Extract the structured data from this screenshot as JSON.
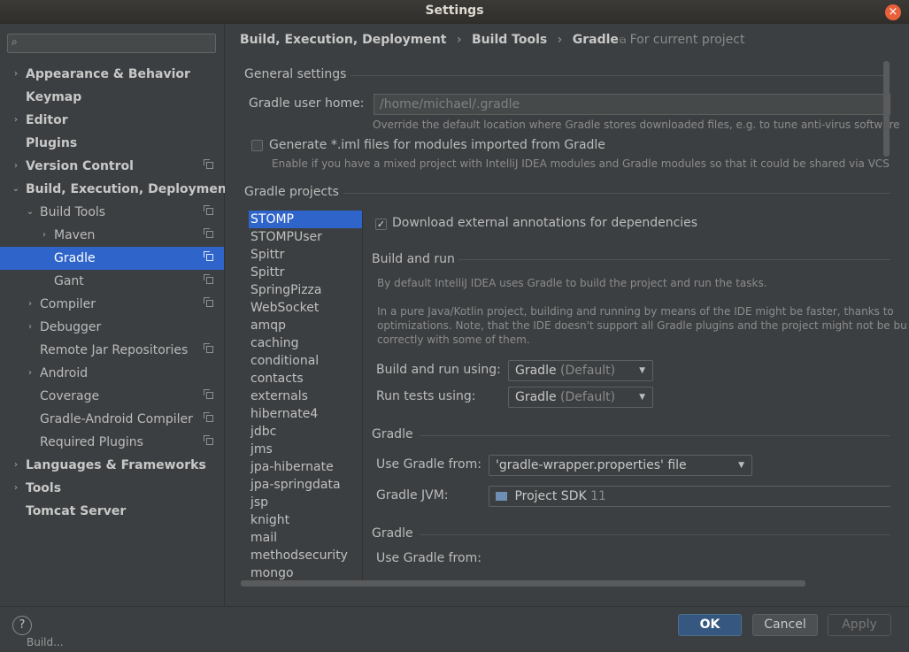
{
  "window": {
    "title": "Settings",
    "close": "×"
  },
  "search": {
    "placeholder": "",
    "icon": "search-icon"
  },
  "sidebar": {
    "items": [
      {
        "label": "Appearance & Behavior",
        "arrow": "›",
        "bold": true
      },
      {
        "label": "Keymap",
        "bold": true
      },
      {
        "label": "Editor",
        "arrow": "›",
        "bold": true
      },
      {
        "label": "Plugins",
        "bold": true
      },
      {
        "label": "Version Control",
        "arrow": "›",
        "bold": true
      },
      {
        "label": "Build, Execution, Deployment",
        "arrow": "⌄",
        "bold": true
      },
      {
        "label": "Build Tools",
        "arrow": "⌄"
      },
      {
        "label": "Maven",
        "arrow": "›"
      },
      {
        "label": "Gradle",
        "selected": true
      },
      {
        "label": "Gant"
      },
      {
        "label": "Compiler",
        "arrow": "›"
      },
      {
        "label": "Debugger",
        "arrow": "›"
      },
      {
        "label": "Remote Jar Repositories"
      },
      {
        "label": "Android",
        "arrow": "›"
      },
      {
        "label": "Coverage"
      },
      {
        "label": "Gradle-Android Compiler"
      },
      {
        "label": "Required Plugins"
      },
      {
        "label": "Languages & Frameworks",
        "arrow": "›",
        "bold": true
      },
      {
        "label": "Tools",
        "arrow": "›",
        "bold": true
      },
      {
        "label": "Tomcat Server",
        "bold": true
      }
    ]
  },
  "breadcrumb": {
    "parts": [
      "Build, Execution, Deployment",
      "Build Tools",
      "Gradle"
    ],
    "separator": "›",
    "scope": "For current project"
  },
  "general": {
    "heading": "General settings",
    "user_home_label": "Gradle user home:",
    "user_home_value": "/home/michael/.gradle",
    "user_home_hint": "Override the default location where Gradle stores downloaded files, e.g. to tune anti-virus software",
    "generate_iml_label": "Generate *.iml files for modules imported from Gradle",
    "generate_iml_checked": false,
    "generate_iml_hint": "Enable if you have a mixed project with IntelliJ IDEA modules and Gradle modules so that it could be shared via VCS"
  },
  "projects": {
    "heading": "Gradle projects",
    "list": [
      "STOMP",
      "STOMPUser",
      "Spittr",
      "Spittr",
      "SpringPizza",
      "WebSocket",
      "amqp",
      "caching",
      "conditional",
      "contacts",
      "externals",
      "hibernate4",
      "jdbc",
      "jms",
      "jpa-hibernate",
      "jpa-springdata",
      "jsp",
      "knight",
      "mail",
      "methodsecurity",
      "mongo"
    ],
    "selected": "STOMP"
  },
  "project_settings": {
    "download_annotations_label": "Download external annotations for dependencies",
    "download_annotations_checked": true,
    "build_run_heading": "Build and run",
    "build_run_hint1": "By default IntelliJ IDEA uses Gradle to build the project and run the tasks.",
    "build_run_hint2": "In a pure Java/Kotlin project, building and running by means of the IDE might be faster, thanks to",
    "build_run_hint3": "optimizations. Note, that the IDE doesn't support all Gradle plugins and the project might not be bu",
    "build_run_hint4": "correctly with some of them.",
    "build_run_using_label": "Build and run using:",
    "build_run_using_value": "Gradle",
    "build_run_using_suffix": "(Default)",
    "run_tests_label": "Run tests using:",
    "run_tests_value": "Gradle",
    "run_tests_suffix": "(Default)",
    "gradle_heading": "Gradle",
    "use_gradle_from_label": "Use Gradle from:",
    "use_gradle_from_value": "'gradle-wrapper.properties' file",
    "gradle_jvm_label": "Gradle JVM:",
    "gradle_jvm_value": "Project SDK",
    "gradle_jvm_version": "11",
    "gradle_heading2": "Gradle",
    "use_gradle_from_label2": "Use Gradle from:"
  },
  "footer": {
    "help": "?",
    "ok": "OK",
    "cancel": "Cancel",
    "apply": "Apply",
    "apply_enabled": false,
    "behind_text": "Build..."
  },
  "colors": {
    "selection": "#2f65ca",
    "ok_button": "#365880",
    "close_button": "#e9613a"
  }
}
